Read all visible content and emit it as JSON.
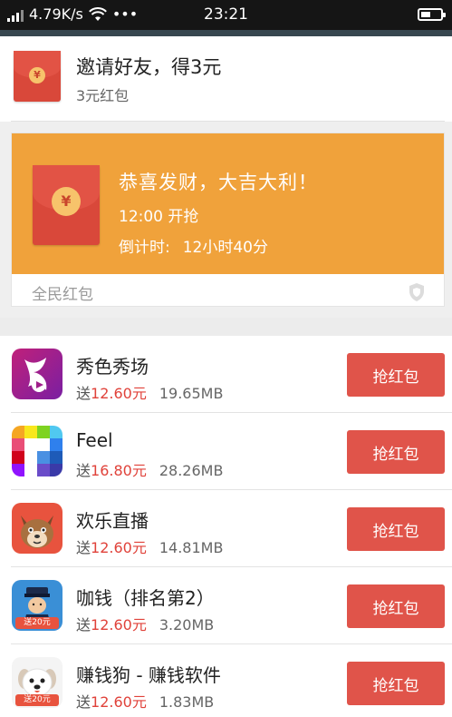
{
  "status_bar": {
    "speed": "4.79K/s",
    "dots": "•••",
    "time": "23:21"
  },
  "invite": {
    "title": "邀请好友，得3元",
    "subtitle": "3元红包",
    "coin_symbol": "¥"
  },
  "banner": {
    "headline": "恭喜发财，大吉大利！",
    "start_time": "12:00 开抢",
    "countdown_label": "倒计时:",
    "countdown_value": "12小时40分",
    "footer_label": "全民红包",
    "background_color": "#f0a23b",
    "coin_symbol": "¥"
  },
  "apps": [
    {
      "name": "秀色秀场",
      "reward_prefix": "送",
      "reward": "12.60元",
      "size": "19.65MB",
      "button": "抢红包",
      "icon": "xiuse-app-icon"
    },
    {
      "name": "Feel",
      "reward_prefix": "送",
      "reward": "16.80元",
      "size": "28.26MB",
      "button": "抢红包",
      "icon": "feel-app-icon"
    },
    {
      "name": "欢乐直播",
      "reward_prefix": "送",
      "reward": "12.60元",
      "size": "14.81MB",
      "button": "抢红包",
      "icon": "huanle-app-icon"
    },
    {
      "name": "咖钱（排名第2）",
      "reward_prefix": "送",
      "reward": "12.60元",
      "size": "3.20MB",
      "button": "抢红包",
      "icon": "kaqian-app-icon",
      "icon_tag": "送20元"
    },
    {
      "name": "赚钱狗 - 赚钱软件",
      "reward_prefix": "送",
      "reward": "12.60元",
      "size": "1.83MB",
      "button": "抢红包",
      "icon": "zhuanqiangou-app-icon",
      "icon_tag": "送20元"
    }
  ],
  "colors": {
    "accent_red": "#e0544a",
    "reward_red": "#e0423a",
    "banner_orange": "#f0a23b"
  }
}
